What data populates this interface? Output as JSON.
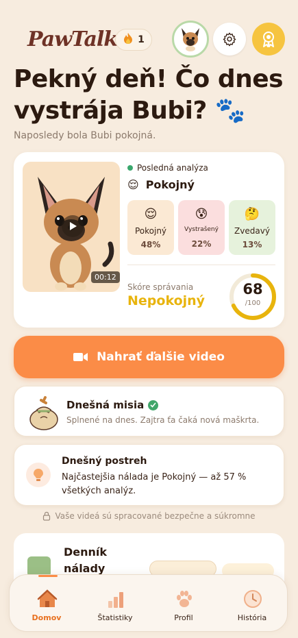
{
  "app": {
    "logo": "PawTalk",
    "streak_count": "1"
  },
  "hero": {
    "title": "Pekný deň! Čo dnes vystrája Bubi? 🐾",
    "subtitle": "Naposledy bola Bubi pokojná."
  },
  "analysis": {
    "label": "Posledná analýza",
    "mood_emoji": "😌",
    "mood": "Pokojný",
    "duration": "00:12",
    "tiles": [
      {
        "emoji": "😌",
        "name": "Pokojný",
        "pct": "48%"
      },
      {
        "emoji": "😰",
        "name": "Vystrašený",
        "pct": "22%"
      },
      {
        "emoji": "🤔",
        "name": "Zvedavý",
        "pct": "13%"
      }
    ],
    "score_label": "Skóre správania",
    "score_value": "Nepokojný",
    "score_num": "68",
    "score_max": "/100",
    "score_fraction": 0.68
  },
  "upload": {
    "label": "Nahrať ďalšie video"
  },
  "mission": {
    "title": "Dnešná misia",
    "desc": "Splnené na dnes. Zajtra ťa čaká nová maškrta."
  },
  "tip": {
    "title": "Dnešný postreh",
    "desc": "Najčastejšia nálada je Pokojný — až 57 % všetkých analýz."
  },
  "privacy": {
    "text": "Vaše videá sú spracované bezpečne a súkromne"
  },
  "journal": {
    "title": "Denník nálady"
  },
  "nav": [
    {
      "label": "Domov",
      "icon": "home-icon"
    },
    {
      "label": "Štatistiky",
      "icon": "chart-icon"
    },
    {
      "label": "Profil",
      "icon": "paw-icon"
    },
    {
      "label": "História",
      "icon": "clock-icon"
    }
  ],
  "colors": {
    "accent": "#fb8c47",
    "score": "#e8b40d",
    "badge": "#f6c440",
    "success": "#41a66a"
  }
}
